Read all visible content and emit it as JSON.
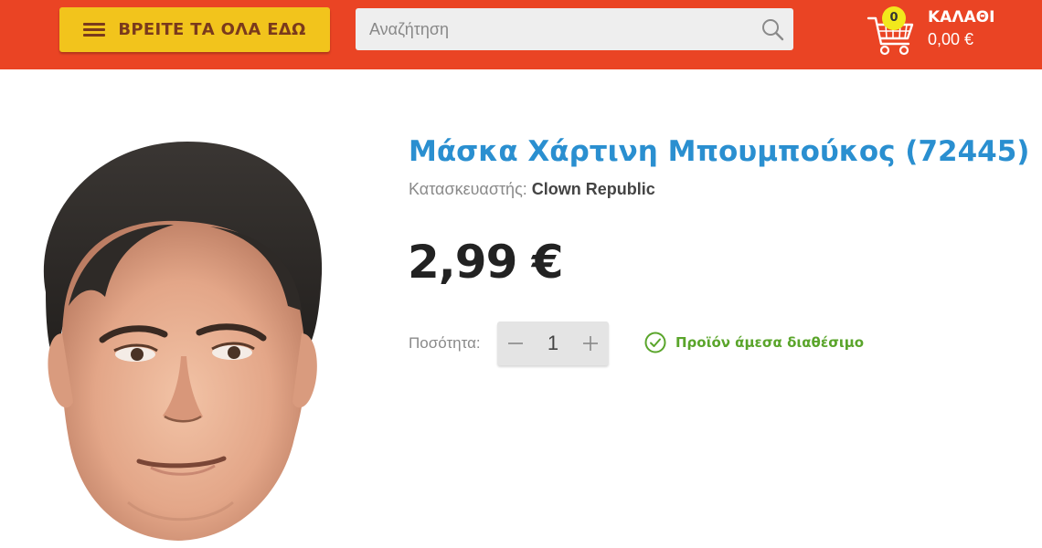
{
  "header": {
    "menu_label": "ΒΡΕΙΤΕ ΤΑ ΟΛΑ ΕΔΩ",
    "search_placeholder": "Αναζήτηση",
    "cart": {
      "count": "0",
      "title": "ΚΑΛΑΘΙ",
      "total": "0,00 €"
    }
  },
  "product": {
    "title": "Μάσκα Χάρτινη Μπουμπούκος (72445)",
    "manufacturer_label": "Κατασκευαστής:",
    "manufacturer_name": "Clown Republic",
    "price": "2,99 €",
    "quantity_label": "Ποσότητα:",
    "quantity_value": "1",
    "availability": "Προϊόν άμεσα διαθέσιμο"
  },
  "icons": {
    "menu": "hamburger-icon",
    "search": "search-icon",
    "cart": "cart-icon",
    "minus": "minus-icon",
    "plus": "plus-icon",
    "availability": "check-circle-icon"
  },
  "colors": {
    "header_bg": "#ea4424",
    "menu_button_bg": "#f2c41c",
    "title": "#2a8fd0",
    "availability": "#5aa52b",
    "badge": "#f2e81c"
  }
}
